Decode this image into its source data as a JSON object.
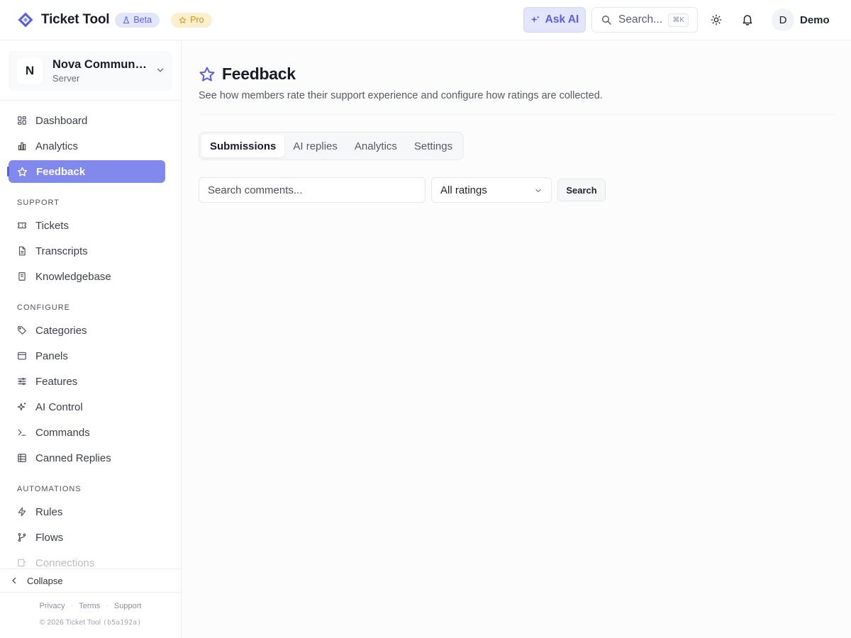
{
  "app": {
    "name": "Ticket Tool",
    "beta_badge": "Beta",
    "pro_badge": "Pro",
    "accent": "#5a60d8",
    "active_nav_bg": "#8289ec"
  },
  "header": {
    "ask_ai": "Ask AI",
    "search_placeholder": "Search...",
    "search_shortcut": "⌘K",
    "theme_icon": "sun-icon",
    "notifications_icon": "bell-icon",
    "user_initial": "D",
    "user_name": "Demo"
  },
  "server": {
    "initial": "N",
    "name": "Nova Community",
    "type": "Server"
  },
  "sidebar": {
    "main_items": [
      {
        "label": "Dashboard",
        "icon": "grid-icon"
      },
      {
        "label": "Analytics",
        "icon": "bar-chart-icon"
      },
      {
        "label": "Feedback",
        "icon": "star-icon",
        "active": true
      }
    ],
    "support_title": "SUPPORT",
    "support_items": [
      {
        "label": "Tickets",
        "icon": "ticket-icon"
      },
      {
        "label": "Transcripts",
        "icon": "file-icon"
      },
      {
        "label": "Knowledgebase",
        "icon": "book-icon"
      }
    ],
    "configure_title": "CONFIGURE",
    "configure_items": [
      {
        "label": "Categories",
        "icon": "tag-icon"
      },
      {
        "label": "Panels",
        "icon": "panel-icon"
      },
      {
        "label": "Features",
        "icon": "sliders-icon"
      },
      {
        "label": "AI Control",
        "icon": "sparkles-icon"
      },
      {
        "label": "Commands",
        "icon": "terminal-icon"
      },
      {
        "label": "Canned Replies",
        "icon": "list-icon"
      }
    ],
    "automations_title": "AUTOMATIONS",
    "automation_items": [
      {
        "label": "Rules",
        "icon": "bolt-icon"
      },
      {
        "label": "Flows",
        "icon": "git-branch-icon"
      },
      {
        "label": "Connections",
        "icon": "plug-icon"
      }
    ],
    "collapse": "Collapse",
    "footer_links": [
      "Privacy",
      "Terms",
      "Support"
    ],
    "copyright": "© 2026 Ticket Tool",
    "build": "(b5a192a)"
  },
  "page": {
    "title": "Feedback",
    "subtitle": "See how members rate their support experience and configure how ratings are collected.",
    "tabs": [
      {
        "label": "Submissions",
        "active": true
      },
      {
        "label": "AI replies"
      },
      {
        "label": "Analytics"
      },
      {
        "label": "Settings"
      }
    ],
    "comment_search_placeholder": "Search comments...",
    "rating_filter": "All ratings",
    "search_button": "Search"
  }
}
